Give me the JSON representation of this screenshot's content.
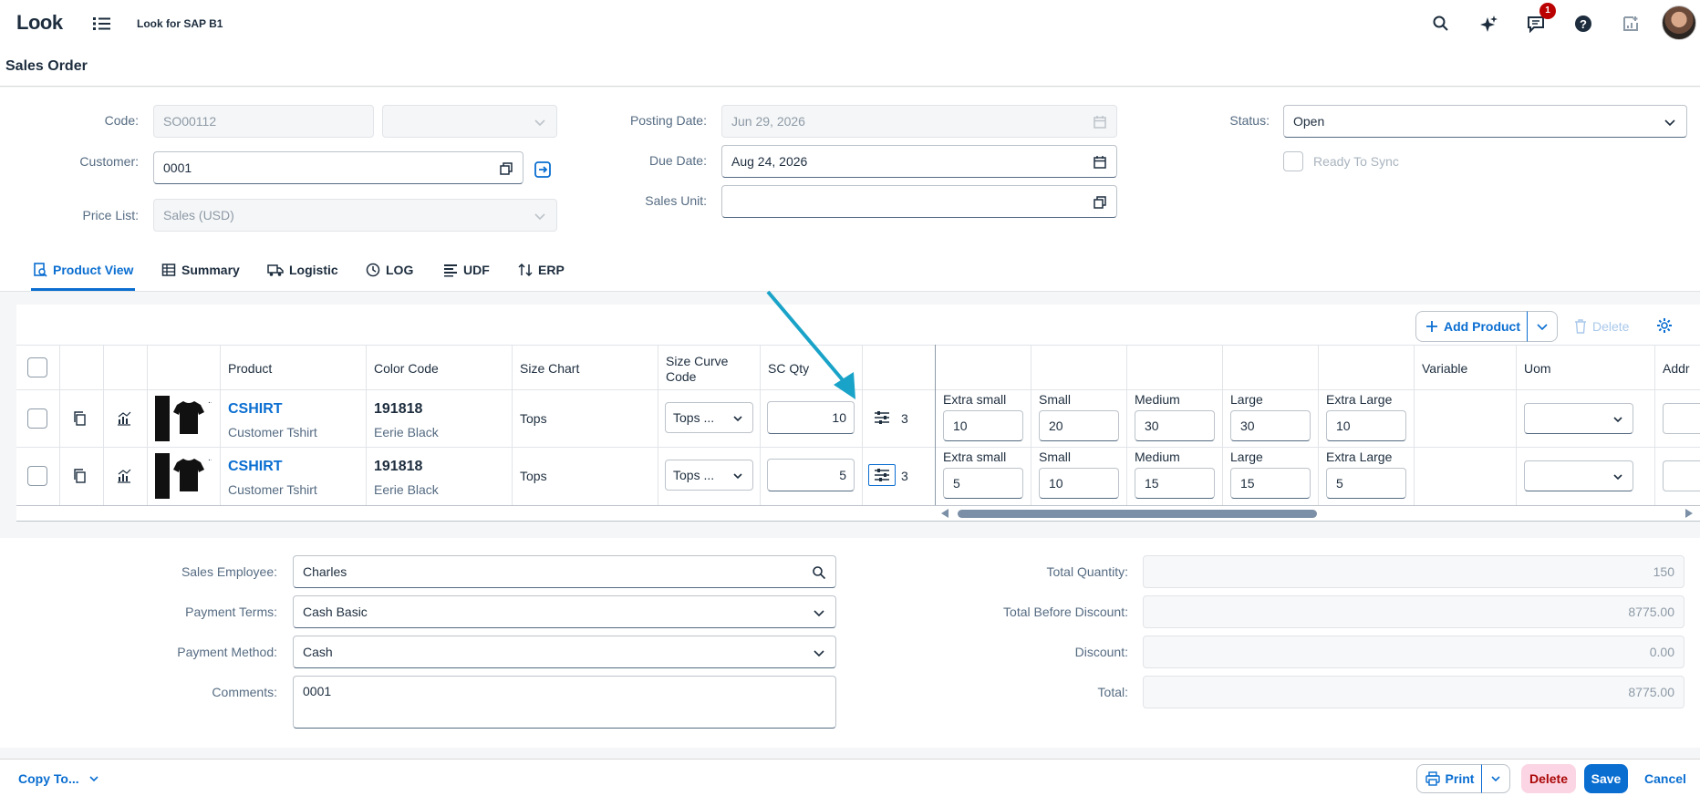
{
  "shell": {
    "logo": "Look",
    "app_title": "Look for SAP B1",
    "notification_count": "1",
    "icons": [
      "menu-icon",
      "search-icon",
      "sparkle-ai-icon",
      "notifications-icon",
      "help-icon",
      "product-switch-icon",
      "user-avatar"
    ]
  },
  "page": {
    "title": "Sales Order"
  },
  "header_form": {
    "code_label": "Code:",
    "code_value": "SO00112",
    "series_value": "",
    "customer_label": "Customer:",
    "customer_value": "0001",
    "price_list_label": "Price List:",
    "price_list_value": "Sales (USD)",
    "posting_date_label": "Posting Date:",
    "posting_date_value": "Jun 29, 2026",
    "due_date_label": "Due Date:",
    "due_date_value": "Aug 24, 2026",
    "sales_unit_label": "Sales Unit:",
    "sales_unit_value": "",
    "status_label": "Status:",
    "status_value": "Open",
    "ready_to_sync_label": "Ready To Sync"
  },
  "tabs": [
    {
      "label": "Product View",
      "icon": "product-view-icon",
      "active": true
    },
    {
      "label": "Summary",
      "icon": "table-icon"
    },
    {
      "label": "Logistic",
      "icon": "truck-icon"
    },
    {
      "label": "LOG",
      "icon": "history-icon"
    },
    {
      "label": "UDF",
      "icon": "list-icon"
    },
    {
      "label": "ERP",
      "icon": "sort-icon"
    }
  ],
  "toolbar": {
    "add_product": "Add Product",
    "delete": "Delete"
  },
  "table": {
    "headers": {
      "product": "Product",
      "color_code": "Color Code",
      "size_chart": "Size Chart",
      "size_curve_code_1": "Size Curve",
      "size_curve_code_2": "Code",
      "sc_qty": "SC Qty",
      "variable": "Variable",
      "uom": "Uom",
      "addr": "Addr"
    },
    "rows": [
      {
        "product": "CSHIRT",
        "product_desc": "Customer Tshirt",
        "color_code": "191818",
        "color_name": "Eerie Black",
        "size_chart": "Tops",
        "size_curve": "Tops ...",
        "sc_qty": "10",
        "curve_count": "3",
        "sizes": [
          {
            "label": "Extra small",
            "qty": "10"
          },
          {
            "label": "Small",
            "qty": "20"
          },
          {
            "label": "Medium",
            "qty": "30"
          },
          {
            "label": "Large",
            "qty": "30"
          },
          {
            "label": "Extra Large",
            "qty": "10"
          }
        ],
        "uom": ""
      },
      {
        "product": "CSHIRT",
        "product_desc": "Customer Tshirt",
        "color_code": "191818",
        "color_name": "Eerie Black",
        "size_chart": "Tops",
        "size_curve": "Tops ...",
        "sc_qty": "5",
        "curve_count": "3",
        "sizes": [
          {
            "label": "Extra small",
            "qty": "5"
          },
          {
            "label": "Small",
            "qty": "10"
          },
          {
            "label": "Medium",
            "qty": "15"
          },
          {
            "label": "Large",
            "qty": "15"
          },
          {
            "label": "Extra Large",
            "qty": "5"
          }
        ],
        "uom": ""
      }
    ]
  },
  "footer_form": {
    "sales_employee_label": "Sales Employee:",
    "sales_employee_value": "Charles",
    "payment_terms_label": "Payment Terms:",
    "payment_terms_value": "Cash Basic",
    "payment_method_label": "Payment Method:",
    "payment_method_value": "Cash",
    "comments_label": "Comments:",
    "comments_value": "0001",
    "total_quantity_label": "Total Quantity:",
    "total_quantity_value": "150",
    "total_before_discount_label": "Total Before Discount:",
    "total_before_discount_value": "8775.00",
    "discount_label": "Discount:",
    "discount_value": "0.00",
    "total_label": "Total:",
    "total_value": "8775.00"
  },
  "bottombar": {
    "copy_to": "Copy To...",
    "print": "Print",
    "delete": "Delete",
    "save": "Save",
    "cancel": "Cancel"
  },
  "colors": {
    "accent": "#0a6ed1",
    "annotation_arrow": "#1aa3c8",
    "delete_bg": "#fbd5e3",
    "badge": "#bb0000"
  }
}
